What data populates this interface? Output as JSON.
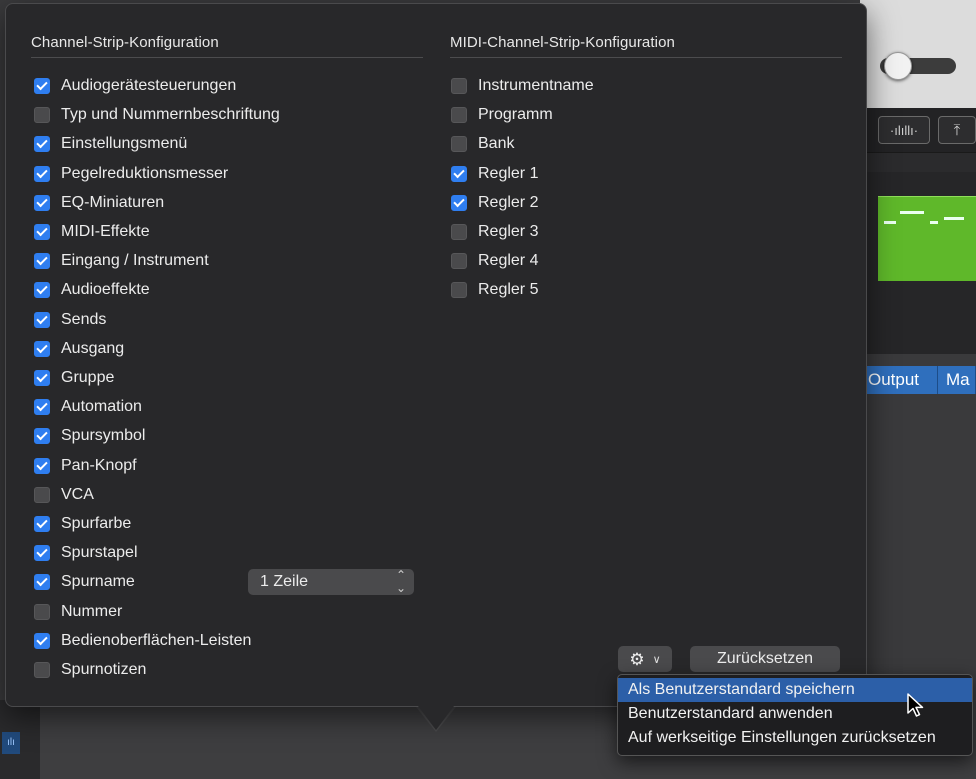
{
  "popover": {
    "left_section": {
      "title": "Channel-Strip-Konfiguration",
      "items": [
        {
          "label": "Audiogerätesteuerungen",
          "checked": true
        },
        {
          "label": "Typ und Nummernbeschriftung",
          "checked": false
        },
        {
          "label": "Einstellungsmenü",
          "checked": true
        },
        {
          "label": "Pegelreduktionsmesser",
          "checked": true
        },
        {
          "label": "EQ-Miniaturen",
          "checked": true
        },
        {
          "label": "MIDI-Effekte",
          "checked": true
        },
        {
          "label": "Eingang / Instrument",
          "checked": true
        },
        {
          "label": "Audioeffekte",
          "checked": true
        },
        {
          "label": "Sends",
          "checked": true
        },
        {
          "label": "Ausgang",
          "checked": true
        },
        {
          "label": "Gruppe",
          "checked": true
        },
        {
          "label": "Automation",
          "checked": true
        },
        {
          "label": "Spursymbol",
          "checked": true
        },
        {
          "label": "Pan-Knopf",
          "checked": true
        },
        {
          "label": "VCA",
          "checked": false
        },
        {
          "label": "Spurfarbe",
          "checked": true
        },
        {
          "label": "Spurstapel",
          "checked": true
        },
        {
          "label": "Spurname",
          "checked": true
        },
        {
          "label": "Nummer",
          "checked": false
        },
        {
          "label": "Bedienoberflächen-Leisten",
          "checked": true
        },
        {
          "label": "Spurnotizen",
          "checked": false
        }
      ],
      "track_name_select": {
        "value": "1 Zeile"
      }
    },
    "right_section": {
      "title": "MIDI-Channel-Strip-Konfiguration",
      "items": [
        {
          "label": "Instrumentname",
          "checked": false
        },
        {
          "label": "Programm",
          "checked": false
        },
        {
          "label": "Bank",
          "checked": false
        },
        {
          "label": "Regler 1",
          "checked": true
        },
        {
          "label": "Regler 2",
          "checked": true
        },
        {
          "label": "Regler 3",
          "checked": false
        },
        {
          "label": "Regler 4",
          "checked": false
        },
        {
          "label": "Regler 5",
          "checked": false
        }
      ]
    },
    "reset_label": "Zurücksetzen"
  },
  "menu": {
    "items": [
      {
        "label": "Als Benutzerstandard speichern",
        "highlighted": true
      },
      {
        "label": "Benutzerstandard anwenden",
        "highlighted": false
      },
      {
        "label": "Auf werkseitige Einstellungen zurücksetzen",
        "highlighted": false
      }
    ]
  },
  "background": {
    "tabs": [
      "Output",
      "Ma"
    ]
  },
  "colors": {
    "accent": "#2f7ef0",
    "menu_highlight": "#2c5fa8",
    "region_green": "#5fb82a",
    "tab_blue": "#2f6fbd"
  },
  "icons": {
    "gear": "gear-icon",
    "waveform": "waveform-icon",
    "vertical_zoom": "vertical-zoom-icon",
    "cursor": "mouse-pointer-icon"
  }
}
